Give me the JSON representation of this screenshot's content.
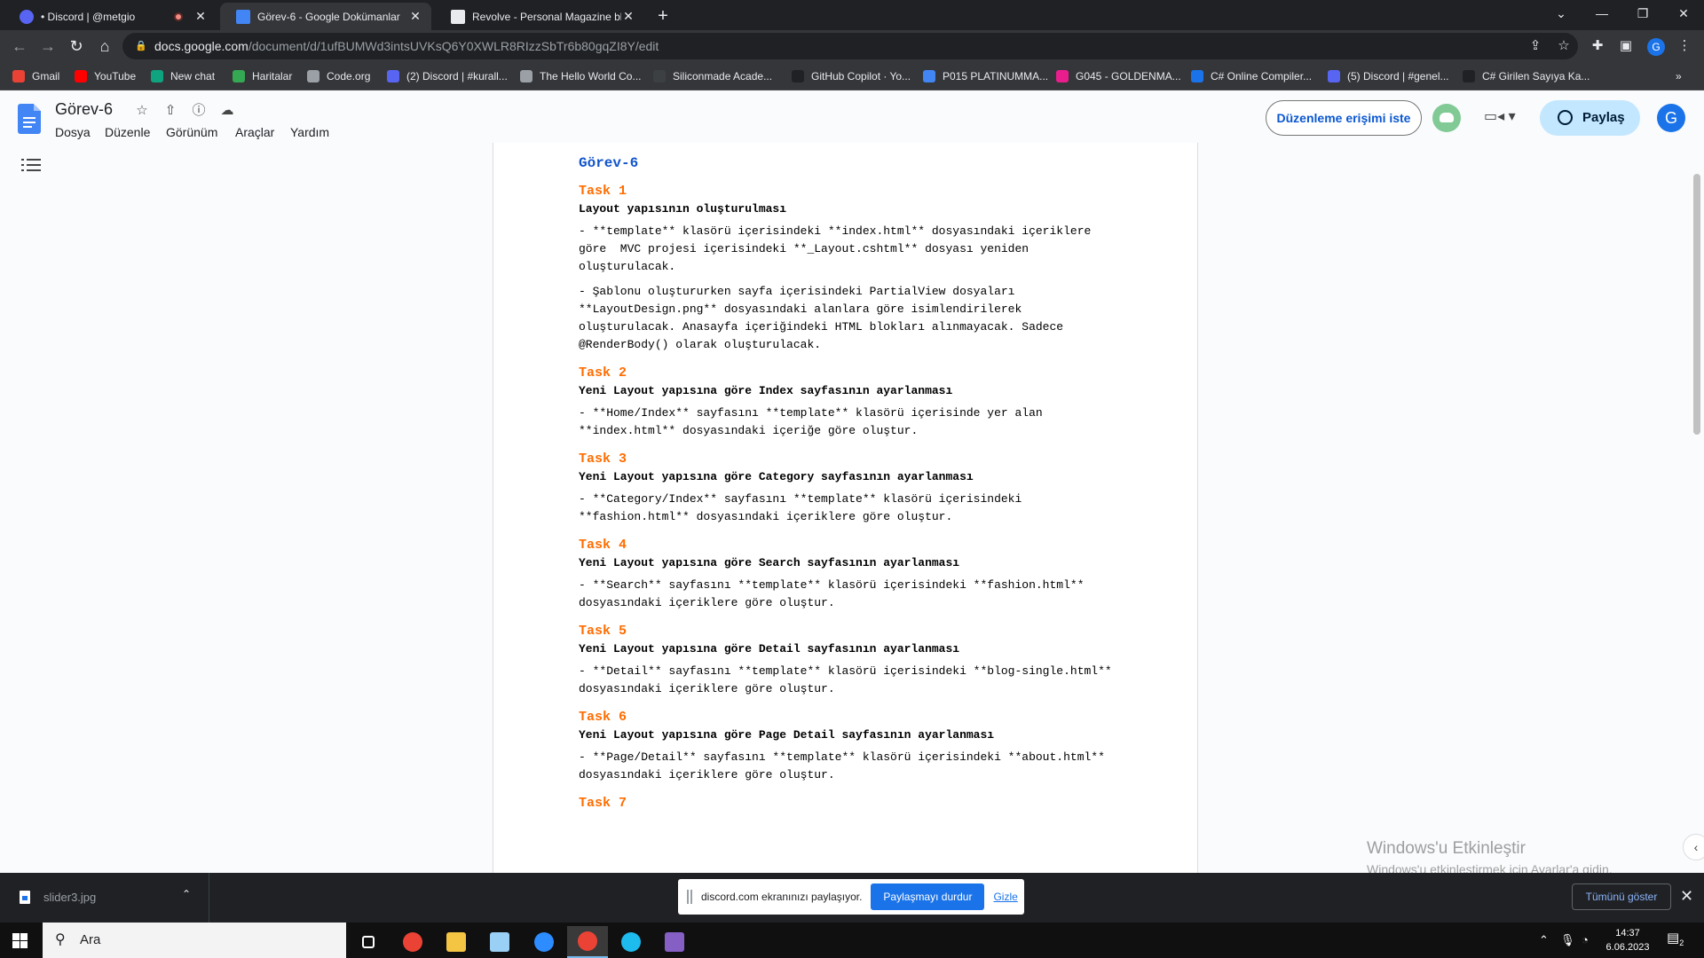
{
  "browser": {
    "tabs": [
      {
        "title": "• Discord | @metgio",
        "active": false,
        "recording": true,
        "favicon_color": "#5865f2"
      },
      {
        "title": "Görev-6 - Google Dokümanlar",
        "active": true,
        "recording": false,
        "favicon_color": "#4285f4"
      },
      {
        "title": "Revolve - Personal Magazine blog",
        "active": false,
        "recording": false,
        "favicon_color": "#e8eaed"
      }
    ],
    "url_host": "docs.google.com",
    "url_path": "/document/d/1ufBUMWd3intsUVKsQ6Y0XWLR8RIzzSbTr6b80gqZI8Y/edit",
    "profile_initial": "G",
    "bookmarks": [
      {
        "label": "Gmail",
        "color": "#ea4335"
      },
      {
        "label": "YouTube",
        "color": "#ff0000"
      },
      {
        "label": "New chat",
        "color": "#10a37f"
      },
      {
        "label": "Haritalar",
        "color": "#34a853"
      },
      {
        "label": "Code.org",
        "color": "#9aa0a6"
      },
      {
        "label": "(2) Discord | #kurall...",
        "color": "#5865f2"
      },
      {
        "label": "The Hello World Co...",
        "color": "#9aa0a6"
      },
      {
        "label": "Siliconmade Acade...",
        "color": "#3c4043"
      },
      {
        "label": "GitHub Copilot · Yo...",
        "color": "#202124"
      },
      {
        "label": "P015 PLATINUMMA...",
        "color": "#4285f4"
      },
      {
        "label": "G045 - GOLDENMA...",
        "color": "#e91e8c"
      },
      {
        "label": "C# Online Compiler...",
        "color": "#1a73e8"
      },
      {
        "label": "(5) Discord | #genel...",
        "color": "#5865f2"
      },
      {
        "label": "C# Girilen Sayıya Ka...",
        "color": "#202124"
      }
    ]
  },
  "docs": {
    "title": "Görev-6",
    "menu": [
      "Dosya",
      "Düzenle",
      "Görünüm",
      "Araçlar",
      "Yardım"
    ],
    "access_button": "Düzenleme erişimi iste",
    "share_button": "Paylaş",
    "avatar_initial": "G"
  },
  "document": {
    "heading": "Görev-6",
    "tasks": [
      {
        "title": "Task 1",
        "subtitle": "Layout yapısının oluşturulması",
        "paragraphs": [
          "- **template** klasörü içerisindeki **index.html** dosyasındaki içeriklere göre  MVC projesi içerisindeki **_Layout.cshtml** dosyası yeniden oluşturulacak.",
          "- Şablonu oluştururken sayfa içerisindeki PartialView dosyaları **LayoutDesign.png** dosyasındaki alanlara göre isimlendirilerek oluşturulacak. Anasayfa içeriğindeki HTML blokları alınmayacak. Sadece @RenderBody() olarak oluşturulacak."
        ]
      },
      {
        "title": "Task 2",
        "subtitle": "Yeni Layout yapısına göre Index sayfasının ayarlanması",
        "paragraphs": [
          "- **Home/Index** sayfasını **template** klasörü içerisinde yer alan **index.html** dosyasındaki içeriğe göre oluştur."
        ]
      },
      {
        "title": "Task 3",
        "subtitle": "Yeni Layout yapısına göre Category sayfasının ayarlanması",
        "paragraphs": [
          "- **Category/Index** sayfasını **template** klasörü içerisindeki **fashion.html** dosyasındaki içeriklere göre oluştur."
        ]
      },
      {
        "title": "Task 4",
        "subtitle": "Yeni Layout yapısına göre Search sayfasının ayarlanması",
        "paragraphs": [
          "- **Search** sayfasını **template** klasörü içerisindeki **fashion.html** dosyasındaki içeriklere göre oluştur."
        ]
      },
      {
        "title": "Task 5",
        "subtitle": "Yeni Layout yapısına göre Detail sayfasının ayarlanması",
        "paragraphs": [
          "- **Detail** sayfasını **template** klasörü içerisindeki **blog-single.html** dosyasındaki içeriklere göre oluştur."
        ]
      },
      {
        "title": "Task 6",
        "subtitle": "Yeni Layout yapısına göre Page Detail sayfasının ayarlanması",
        "paragraphs": [
          "- **Page/Detail** sayfasını **template** klasörü içerisindeki **about.html** dosyasındaki içeriklere göre oluştur."
        ]
      },
      {
        "title": "Task 7",
        "subtitle": "",
        "paragraphs": []
      }
    ]
  },
  "watermark": {
    "line1": "Windows'u Etkinleştir",
    "line2": "Windows'u etkinleştirmek için Ayarlar'a gidin."
  },
  "download_bar": {
    "file_name": "slider3.jpg",
    "show_all": "Tümünü göster"
  },
  "share_notice": {
    "text": "discord.com ekranınızı paylaşıyor.",
    "stop": "Paylaşmayı durdur",
    "hide": "Gizle"
  },
  "taskbar": {
    "search_placeholder": "Ara",
    "time": "14:37",
    "date": "6.06.2023",
    "notification_count": "2",
    "apps": [
      {
        "name": "task-view",
        "color": "#ffffff"
      },
      {
        "name": "chrome",
        "color": "#ea4335"
      },
      {
        "name": "file-explorer",
        "color": "#f4c542"
      },
      {
        "name": "notepad",
        "color": "#9ad0f5"
      },
      {
        "name": "zoom",
        "color": "#2d8cff"
      },
      {
        "name": "chrome-active",
        "color": "#ea4335"
      },
      {
        "name": "edge",
        "color": "#1ebbee"
      },
      {
        "name": "visual-studio",
        "color": "#865fc5"
      }
    ]
  }
}
